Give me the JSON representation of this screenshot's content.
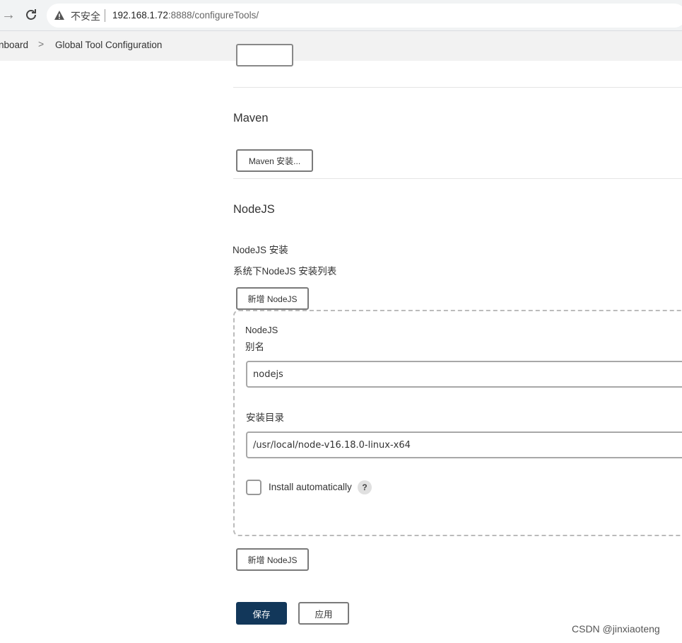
{
  "browser": {
    "not_secure": "不安全",
    "url_host": "192.168.1.72",
    "url_rest": ":8888/configureTools/"
  },
  "breadcrumb": {
    "items": [
      "nboard",
      "Global Tool Configuration"
    ],
    "separator": ">"
  },
  "maven": {
    "title": "Maven",
    "install_button": "Maven 安装..."
  },
  "nodejs": {
    "title": "NodeJS",
    "install_label": "NodeJS 安装",
    "install_list_desc": "系统下NodeJS 安装列表",
    "add_button": "新增 NodeJS",
    "item": {
      "header": "NodeJS",
      "alias_label": "别名",
      "alias_value": "nodejs",
      "dir_label": "安装目录",
      "dir_value": "/usr/local/node-v16.18.0-linux-x64",
      "install_auto_label": "Install automatically",
      "help": "?"
    },
    "add_button_bottom": "新增 NodeJS"
  },
  "actions": {
    "save": "保存",
    "apply": "应用"
  },
  "watermark": "CSDN @jinxiaoteng",
  "colors": {
    "primary": "#12375a",
    "border": "#7a7a7a"
  }
}
